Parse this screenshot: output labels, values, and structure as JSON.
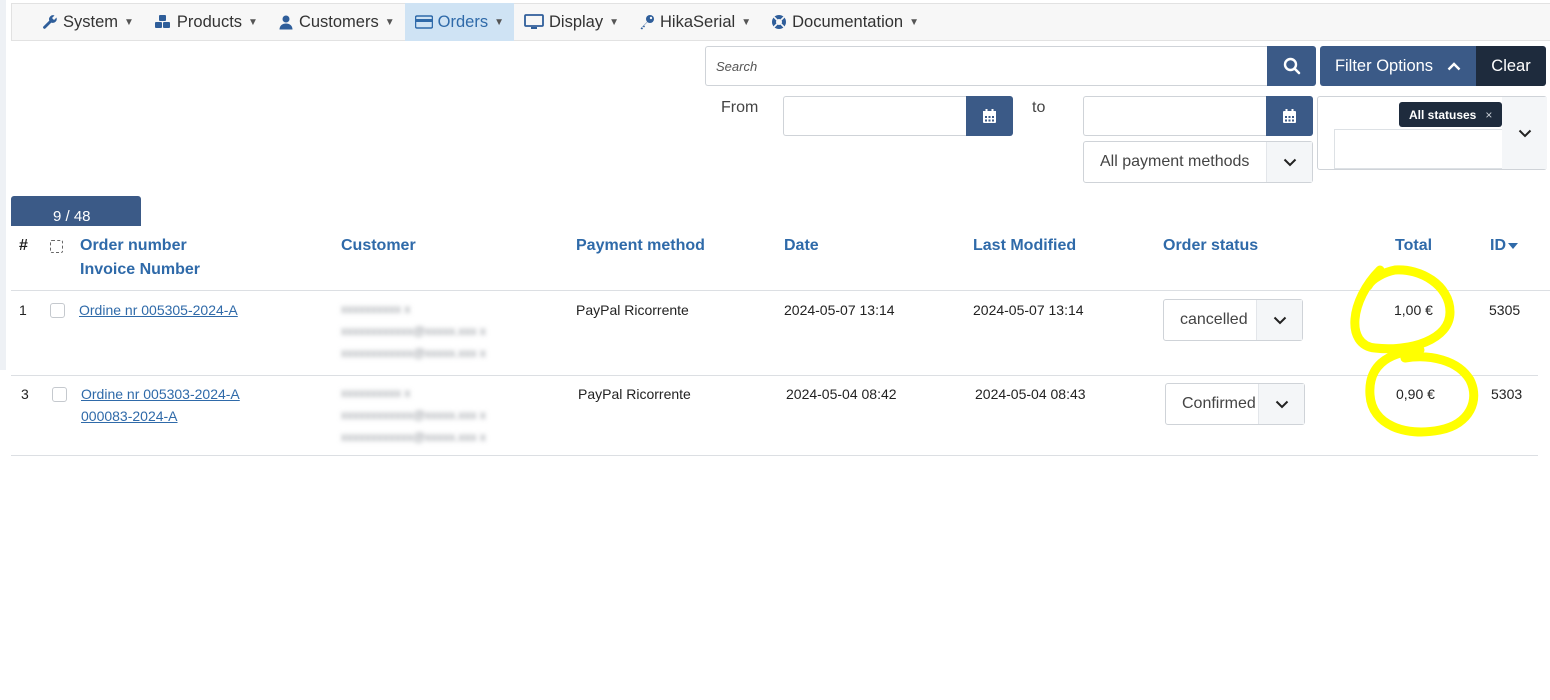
{
  "nav": {
    "items": [
      {
        "label": "System",
        "icon": "wrench-icon"
      },
      {
        "label": "Products",
        "icon": "cubes-icon"
      },
      {
        "label": "Customers",
        "icon": "user-icon"
      },
      {
        "label": "Orders",
        "icon": "credit-card-icon",
        "active": true
      },
      {
        "label": "Display",
        "icon": "monitor-icon"
      },
      {
        "label": "HikaSerial",
        "icon": "key-icon"
      },
      {
        "label": "Documentation",
        "icon": "lifebuoy-icon"
      }
    ]
  },
  "filters": {
    "search_placeholder": "Search",
    "filter_options_label": "Filter Options",
    "clear_label": "Clear",
    "from_label": "From",
    "to_label": "to",
    "payment_method_selected": "All payment methods",
    "status_tag": "All statuses",
    "status_tag_remove": "×"
  },
  "pagination": {
    "label": "9 / 48"
  },
  "table": {
    "headers": {
      "num": "#",
      "order_number": "Order number",
      "invoice_number": "Invoice Number",
      "customer": "Customer",
      "payment_method": "Payment method",
      "date": "Date",
      "last_modified": "Last Modified",
      "order_status": "Order status",
      "total": "Total",
      "id": "ID"
    },
    "rows": [
      {
        "num": "1",
        "order_number": "Ordine nr 005305-2024-A",
        "invoice_number": "",
        "payment_method": "PayPal Ricorrente",
        "date": "2024-05-07 13:14",
        "last_modified": "2024-05-07 13:14",
        "status": "cancelled",
        "total": "1,00 €",
        "id": "5305"
      },
      {
        "num": "3",
        "order_number": "Ordine nr 005303-2024-A",
        "invoice_number": "000083-2024-A",
        "payment_method": "PayPal Ricorrente",
        "date": "2024-05-04 08:42",
        "last_modified": "2024-05-04 08:43",
        "status": "Confirmed",
        "total": "0,90 €",
        "id": "5303"
      }
    ]
  },
  "colors": {
    "primary": "#3b5a87",
    "dark": "#1e2b3d",
    "link": "#2f6aa9",
    "nav_active_bg": "#cfe3f4",
    "highlight": "#ffff00"
  }
}
